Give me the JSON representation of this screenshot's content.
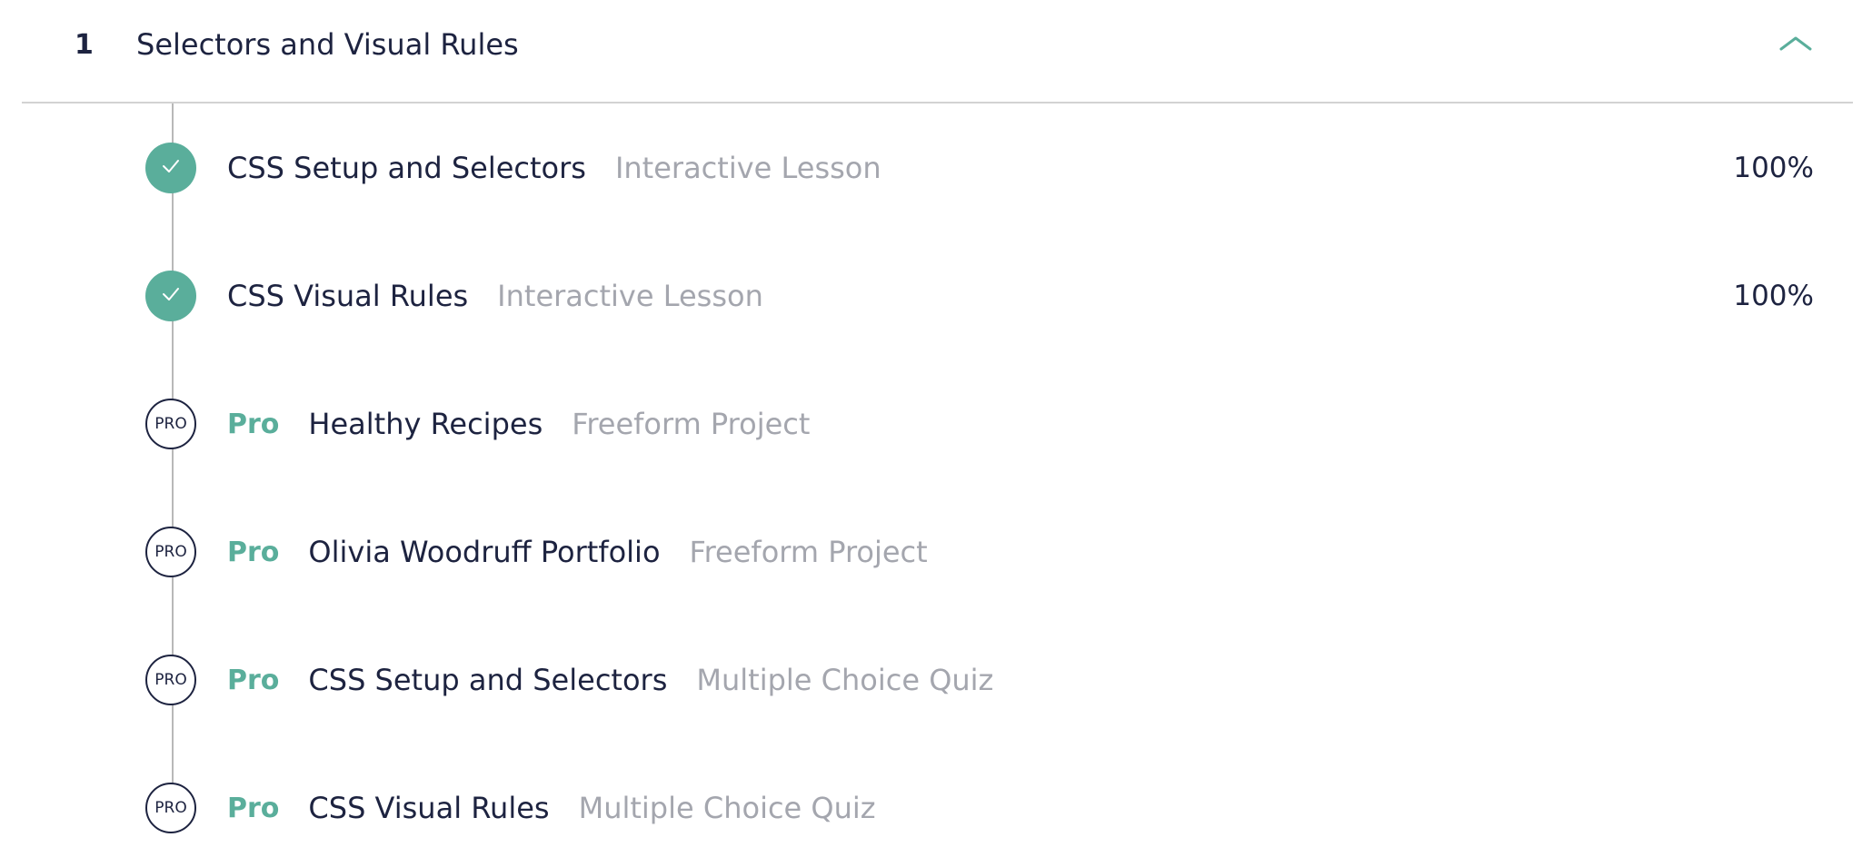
{
  "section": {
    "number": "1",
    "title": "Selectors and Visual Rules",
    "collapse_icon": "chevron-up-icon",
    "accent_color": "#5aae9b"
  },
  "items": [
    {
      "status": "completed",
      "title": "CSS Setup and Selectors",
      "type": "Interactive Lesson",
      "progress": "100%",
      "icon": "check-icon"
    },
    {
      "status": "completed",
      "title": "CSS Visual Rules",
      "type": "Interactive Lesson",
      "progress": "100%",
      "icon": "check-icon"
    },
    {
      "status": "pro",
      "badge": "PRO",
      "pro_label": "Pro",
      "title": "Healthy Recipes",
      "type": "Freeform Project"
    },
    {
      "status": "pro",
      "badge": "PRO",
      "pro_label": "Pro",
      "title": "Olivia Woodruff Portfolio",
      "type": "Freeform Project"
    },
    {
      "status": "pro",
      "badge": "PRO",
      "pro_label": "Pro",
      "title": "CSS Setup and Selectors",
      "type": "Multiple Choice Quiz"
    },
    {
      "status": "pro",
      "badge": "PRO",
      "pro_label": "Pro",
      "title": "CSS Visual Rules",
      "type": "Multiple Choice Quiz"
    }
  ]
}
